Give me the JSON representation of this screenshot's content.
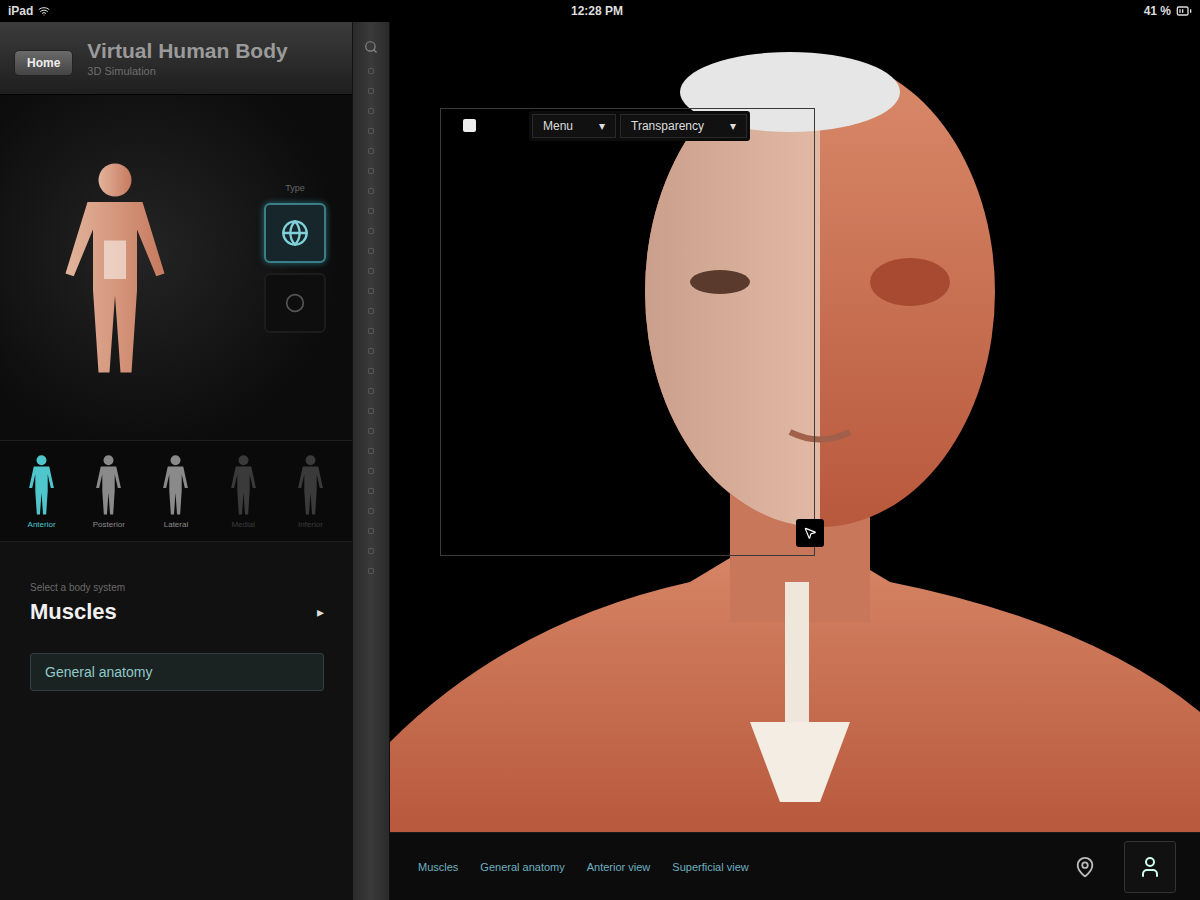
{
  "status_bar": {
    "device": "iPad",
    "time": "12:28 PM",
    "battery": "41 %"
  },
  "header": {
    "home_button": "Home",
    "title": "Virtual Human Body",
    "subtitle": "3D Simulation"
  },
  "type_toggle": {
    "label": "Type",
    "options": [
      {
        "selected": true
      },
      {
        "selected": false
      }
    ]
  },
  "views": [
    {
      "label": "Anterior",
      "selected": true,
      "disabled": false
    },
    {
      "label": "Posterior",
      "selected": false,
      "disabled": false
    },
    {
      "label": "Lateral",
      "selected": false,
      "disabled": false
    },
    {
      "label": "Medial",
      "selected": false,
      "disabled": true
    },
    {
      "label": "Inferior",
      "selected": false,
      "disabled": true
    }
  ],
  "system": {
    "caption": "Select a body system",
    "value": "Muscles",
    "arrow": "▸"
  },
  "category_button": "General anatomy",
  "overlay": {
    "menus": [
      {
        "label": "Menu",
        "arrow": "▾"
      },
      {
        "label": "Transparency",
        "arrow": "▾"
      }
    ]
  },
  "breadcrumbs": [
    "Muscles",
    "General anatomy",
    "Anterior view",
    "Superficial view"
  ]
}
